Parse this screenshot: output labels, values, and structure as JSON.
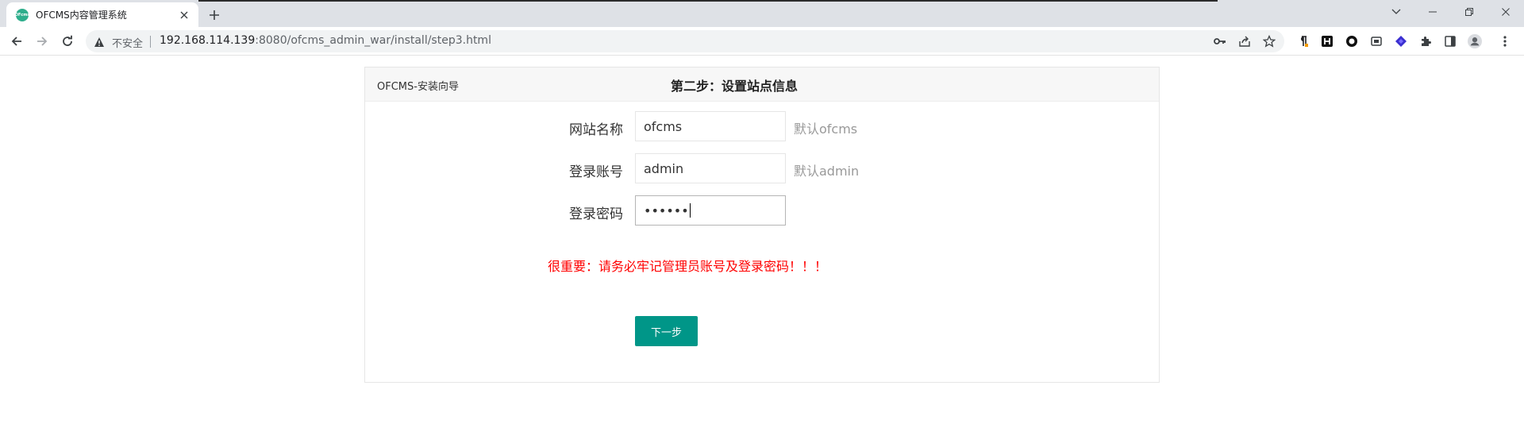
{
  "browser": {
    "tab_title": "OFCMS内容管理系统",
    "favicon_text": "OFcms",
    "not_secure_label": "不安全",
    "url_host": "192.168.114.139",
    "url_rest": ":8080/ofcms_admin_war/install/step3.html"
  },
  "page": {
    "brand": "OFCMS-安装向导",
    "step_title": "第二步：设置站点信息",
    "fields": [
      {
        "label": "网站名称",
        "value": "ofcms",
        "hint": "默认ofcms"
      },
      {
        "label": "登录账号",
        "value": "admin",
        "hint": "默认admin"
      },
      {
        "label": "登录密码",
        "value": "••••••",
        "hint": ""
      }
    ],
    "warning": "很重要：请务必牢记管理员账号及登录密码！！！",
    "next_button": "下一步",
    "colors": {
      "accent": "#009688",
      "warning": "#ff0000",
      "hint": "#999999"
    }
  }
}
